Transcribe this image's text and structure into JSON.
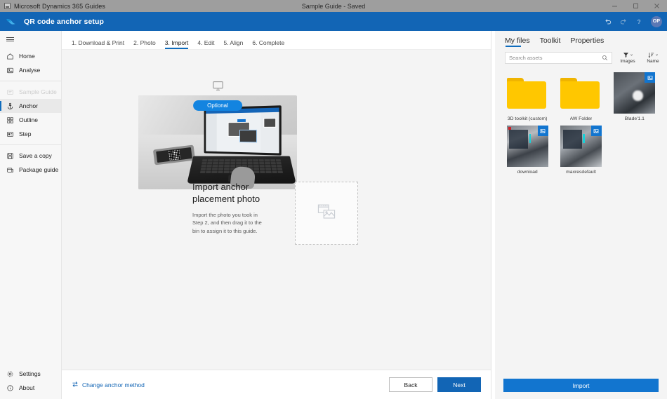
{
  "titlebar": {
    "app_name": "Microsoft Dynamics 365 Guides",
    "document_title": "Sample Guide - Saved",
    "minimize_label": "Minimize",
    "maximize_label": "Maximize",
    "close_label": "Close"
  },
  "appbar": {
    "title": "QR code anchor setup",
    "undo_label": "Undo",
    "redo_label": "Redo",
    "help_label": "Help",
    "avatar_initials": "OP"
  },
  "sidebar": {
    "menu_label": "Menu",
    "group_top": [
      {
        "label": "Home",
        "icon": "home-icon",
        "state": "normal"
      },
      {
        "label": "Analyse",
        "icon": "analyse-icon",
        "state": "normal"
      }
    ],
    "group_guide": [
      {
        "label": "Sample Guide",
        "icon": "guide-icon",
        "state": "disabled"
      },
      {
        "label": "Anchor",
        "icon": "anchor-icon",
        "state": "active"
      },
      {
        "label": "Outline",
        "icon": "outline-icon",
        "state": "normal"
      },
      {
        "label": "Step",
        "icon": "step-icon",
        "state": "normal"
      }
    ],
    "group_actions": [
      {
        "label": "Save a copy",
        "icon": "save-copy-icon",
        "state": "normal"
      },
      {
        "label": "Package guide",
        "icon": "package-icon",
        "state": "normal"
      }
    ],
    "group_bottom": [
      {
        "label": "Settings",
        "icon": "gear-icon",
        "state": "normal"
      },
      {
        "label": "About",
        "icon": "info-icon",
        "state": "normal"
      }
    ]
  },
  "steps": [
    {
      "label": "1. Download & Print",
      "active": false
    },
    {
      "label": "2. Photo",
      "active": false
    },
    {
      "label": "3. Import",
      "active": true
    },
    {
      "label": "4. Edit",
      "active": false
    },
    {
      "label": "5. Align",
      "active": false
    },
    {
      "label": "6. Complete",
      "active": false
    }
  ],
  "main": {
    "optional_badge": "Optional",
    "hero_icon": "monitor-icon",
    "photo_alt": "laptop-on-desk-photo",
    "title": "Import anchor placement photo",
    "description": "Import the photo you took in Step 2, and then drag it to the bin to assign it to this guide.",
    "dropzone_icon": "images-placeholder-icon"
  },
  "actionbar": {
    "change_method_label": "Change anchor method",
    "change_method_icon": "swap-icon",
    "back_label": "Back",
    "next_label": "Next"
  },
  "rightpanel": {
    "tabs": [
      {
        "label": "My files",
        "active": true
      },
      {
        "label": "Toolkit",
        "active": false
      },
      {
        "label": "Properties",
        "active": false
      }
    ],
    "search": {
      "placeholder": "Search assets",
      "value": "",
      "icon": "search-icon"
    },
    "filter": {
      "label": "Images",
      "icon": "filter-icon",
      "chevron": "chevron-down-icon"
    },
    "sort": {
      "label": "Name",
      "icon": "sort-icon",
      "chevron": "chevron-down-icon"
    },
    "files": [
      {
        "name": "3D toolkit (custom)",
        "type": "folder"
      },
      {
        "name": "AW Folder",
        "type": "folder"
      },
      {
        "name": "Blade'1.1",
        "type": "image",
        "style": "ph-a"
      },
      {
        "name": "download",
        "type": "image",
        "style": "ph-b"
      },
      {
        "name": "maxresdefault",
        "type": "image",
        "style": "ph-c"
      }
    ],
    "import_label": "Import"
  },
  "colors": {
    "brand_blue": "#1265b5",
    "accent_blue": "#1275cf",
    "titlebar_gray": "#9e9e9e",
    "folder_yellow": "#ffc700",
    "canvas_gray": "#f4f4f4"
  }
}
